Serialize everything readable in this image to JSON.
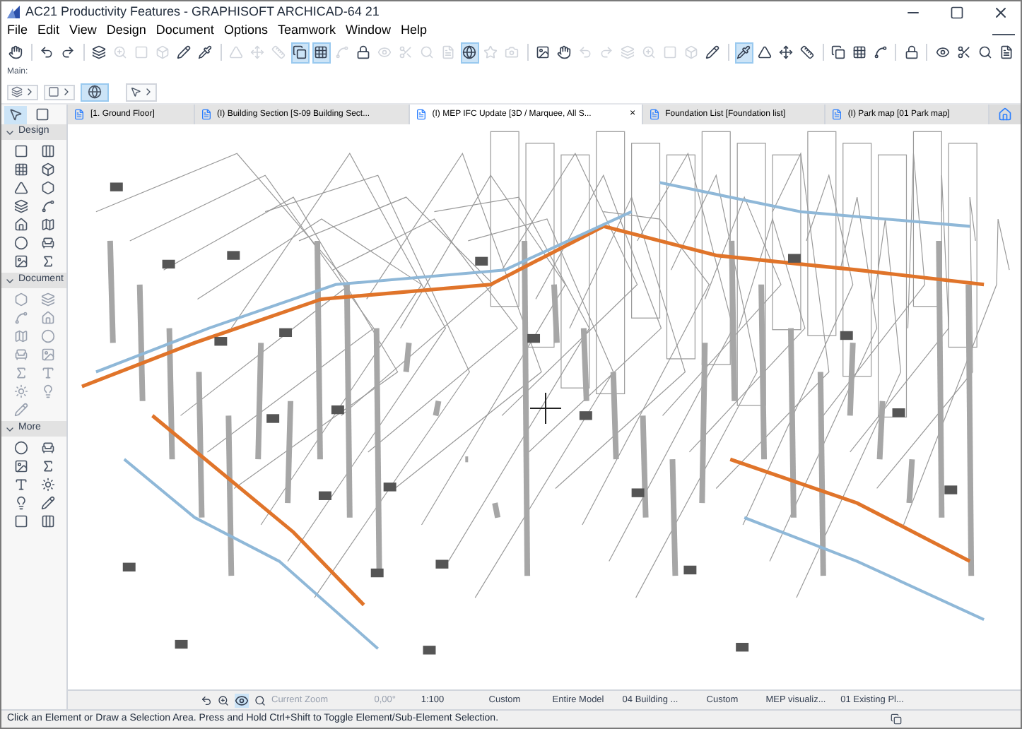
{
  "window": {
    "title": "AC21 Productivity Features - GRAPHISOFT ARCHICAD-64 21"
  },
  "menu": [
    "File",
    "Edit",
    "View",
    "Design",
    "Document",
    "Options",
    "Teamwork",
    "Window",
    "Help"
  ],
  "toolbar": [
    {
      "kind": "button",
      "selected": false,
      "disabled": false
    },
    {
      "kind": "separator"
    },
    {
      "kind": "button",
      "selected": false,
      "disabled": false
    },
    {
      "kind": "button",
      "selected": false,
      "disabled": false
    },
    {
      "kind": "separator"
    },
    {
      "kind": "button",
      "selected": false,
      "disabled": false
    },
    {
      "kind": "button",
      "selected": false,
      "disabled": true
    },
    {
      "kind": "button",
      "selected": false,
      "disabled": true
    },
    {
      "kind": "button",
      "selected": false,
      "disabled": true
    },
    {
      "kind": "button",
      "selected": false,
      "disabled": false
    },
    {
      "kind": "button",
      "selected": false,
      "disabled": false
    },
    {
      "kind": "separator"
    },
    {
      "kind": "button",
      "selected": false,
      "disabled": true
    },
    {
      "kind": "button",
      "selected": false,
      "disabled": true
    },
    {
      "kind": "button",
      "selected": false,
      "disabled": true
    },
    {
      "kind": "button",
      "selected": true,
      "disabled": false
    },
    {
      "kind": "button",
      "selected": true,
      "disabled": false
    },
    {
      "kind": "button",
      "selected": false,
      "disabled": true
    },
    {
      "kind": "button",
      "selected": false,
      "disabled": false
    },
    {
      "kind": "button",
      "selected": false,
      "disabled": true
    },
    {
      "kind": "button",
      "selected": false,
      "disabled": true
    },
    {
      "kind": "button",
      "selected": false,
      "disabled": true
    },
    {
      "kind": "button",
      "selected": false,
      "disabled": true
    },
    {
      "kind": "button",
      "selected": true,
      "disabled": false
    },
    {
      "kind": "button",
      "selected": false,
      "disabled": true
    },
    {
      "kind": "button",
      "selected": false,
      "disabled": true
    },
    {
      "kind": "separator"
    },
    {
      "kind": "button",
      "selected": false,
      "disabled": false
    },
    {
      "kind": "button",
      "selected": false,
      "disabled": false
    },
    {
      "kind": "button",
      "selected": false,
      "disabled": true
    },
    {
      "kind": "button",
      "selected": false,
      "disabled": true
    },
    {
      "kind": "button",
      "selected": false,
      "disabled": true
    },
    {
      "kind": "button",
      "selected": false,
      "disabled": true
    },
    {
      "kind": "button",
      "selected": false,
      "disabled": true
    },
    {
      "kind": "button",
      "selected": false,
      "disabled": true
    },
    {
      "kind": "button",
      "selected": false,
      "disabled": false
    },
    {
      "kind": "separator"
    },
    {
      "kind": "button",
      "selected": true,
      "disabled": false
    },
    {
      "kind": "button",
      "selected": false,
      "disabled": false
    },
    {
      "kind": "button",
      "selected": false,
      "disabled": false
    },
    {
      "kind": "button",
      "selected": false,
      "disabled": false
    },
    {
      "kind": "separator"
    },
    {
      "kind": "button",
      "selected": false,
      "disabled": false
    },
    {
      "kind": "button",
      "selected": false,
      "disabled": false
    },
    {
      "kind": "button",
      "selected": false,
      "disabled": false
    },
    {
      "kind": "separator"
    },
    {
      "kind": "button",
      "selected": false,
      "disabled": false
    },
    {
      "kind": "separator"
    },
    {
      "kind": "button",
      "selected": false,
      "disabled": false
    },
    {
      "kind": "button",
      "selected": false,
      "disabled": false
    },
    {
      "kind": "button",
      "selected": false,
      "disabled": false
    },
    {
      "kind": "button",
      "selected": false,
      "disabled": false
    }
  ],
  "main_label": "Main:",
  "tabs": [
    {
      "label": "[1. Ground Floor]",
      "selected": false,
      "closable": false
    },
    {
      "label": "(I) Building Section [S-09 Building Sect...",
      "selected": false,
      "closable": false
    },
    {
      "label": "(I) MEP IFC Update [3D / Marquee, All S...",
      "selected": true,
      "closable": true
    },
    {
      "label": "Foundation List [Foundation list]",
      "selected": false,
      "closable": false
    },
    {
      "label": "(I) Park map [01 Park map]",
      "selected": false,
      "closable": false
    }
  ],
  "close_glyph": "×",
  "toolbox": {
    "sections": [
      {
        "title": "Design",
        "expanded": true
      },
      {
        "title": "Document",
        "expanded": true
      },
      {
        "title": "More",
        "expanded": true
      }
    ]
  },
  "bottom_bar": {
    "zoom": "Current Zoom",
    "angle": "0,00°",
    "scale": "1:100",
    "pen_set": "Custom",
    "model_filter": "Entire Model",
    "layer_combo": "04 Building ...",
    "dimension": "Custom",
    "view_option": "MEP visualiz...",
    "renovation": "01 Existing Pl..."
  },
  "status_bar": "Click an Element or Draw a Selection Area. Press and Hold Ctrl+Shift to Toggle Element/Sub-Element Selection."
}
